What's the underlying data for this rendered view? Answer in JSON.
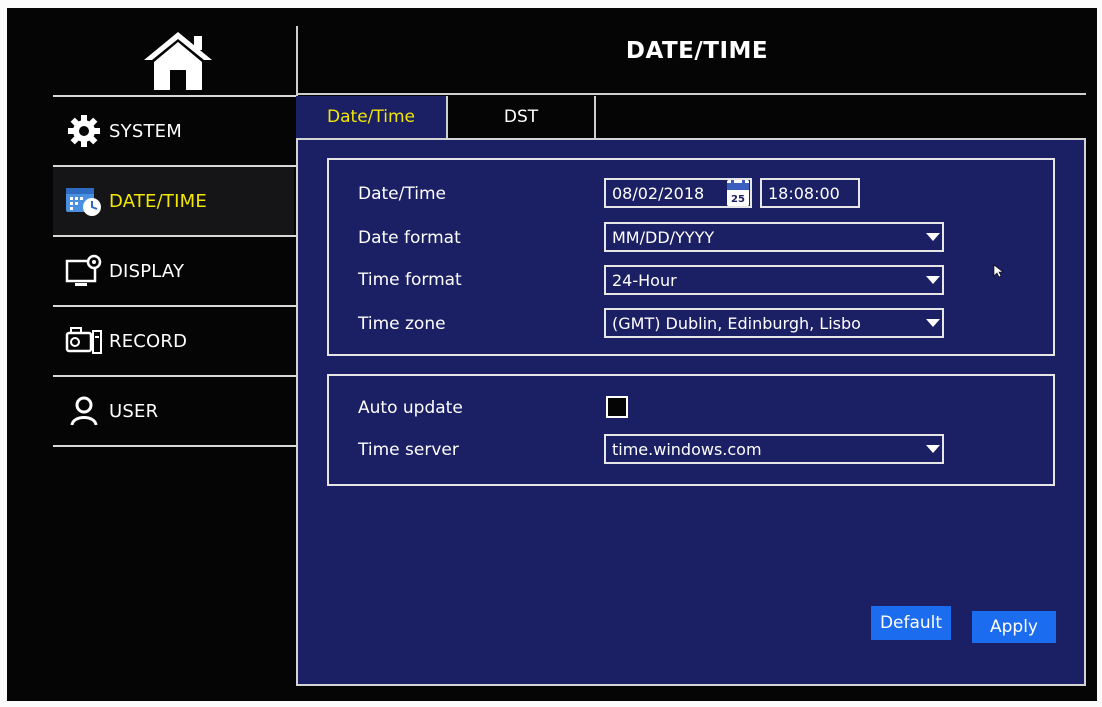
{
  "header": {
    "title": "DATE/TIME"
  },
  "sidebar": {
    "items": [
      {
        "label": "SYSTEM",
        "icon": "gear-icon"
      },
      {
        "label": "DATE/TIME",
        "icon": "calendar-clock-icon",
        "active": true
      },
      {
        "label": "DISPLAY",
        "icon": "monitor-settings-icon"
      },
      {
        "label": "RECORD",
        "icon": "camera-icon"
      },
      {
        "label": "USER",
        "icon": "user-icon"
      }
    ]
  },
  "tabs": [
    {
      "label": "Date/Time",
      "active": true
    },
    {
      "label": "DST",
      "active": false
    }
  ],
  "datetime": {
    "date_label": "Date/Time",
    "date_value": "08/02/2018",
    "calendar_badge": "25",
    "time_value": "18:08:00",
    "date_format_label": "Date format",
    "date_format_value": "MM/DD/YYYY",
    "time_format_label": "Time format",
    "time_format_value": "24-Hour",
    "time_zone_label": "Time zone",
    "time_zone_value": "(GMT) Dublin, Edinburgh, Lisbo"
  },
  "sync": {
    "auto_update_label": "Auto update",
    "auto_update_checked": false,
    "time_server_label": "Time server",
    "time_server_value": "time.windows.com"
  },
  "buttons": {
    "default_label": "Default",
    "apply_label": "Apply"
  },
  "colors": {
    "panel_bg": "#1b1f64",
    "active_text": "#f2e800",
    "button_bg": "#1c6cf0",
    "screen_bg": "#050505"
  }
}
